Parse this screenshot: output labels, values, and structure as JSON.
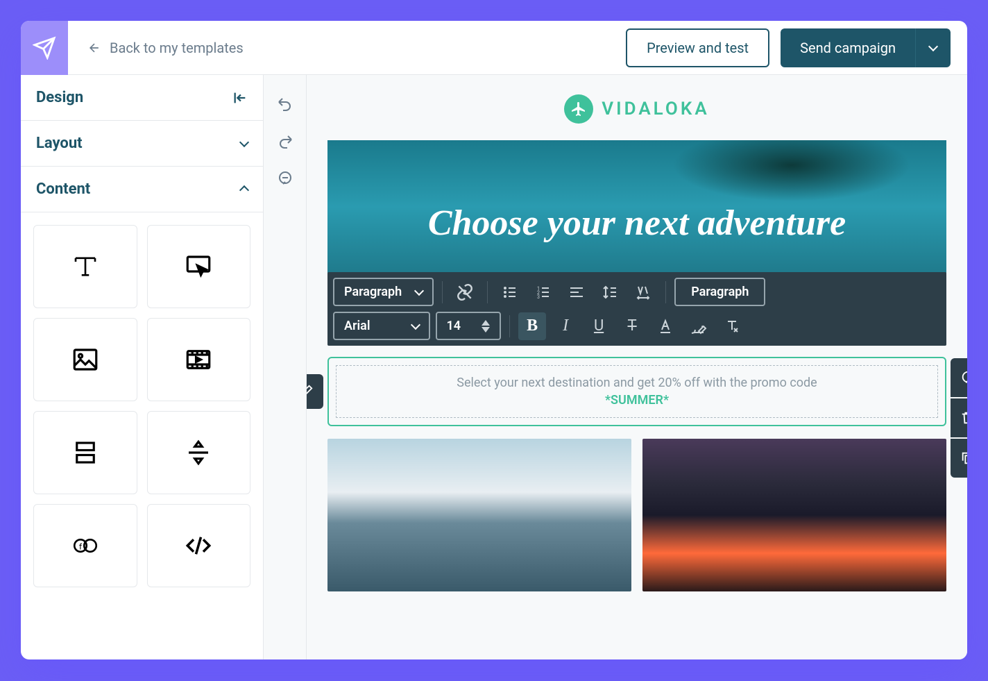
{
  "header": {
    "back_label": "Back to my templates",
    "preview_label": "Preview and test",
    "send_label": "Send campaign"
  },
  "sidebar": {
    "design_label": "Design",
    "layout_label": "Layout",
    "content_label": "Content"
  },
  "brand": {
    "name": "VIDALOKA"
  },
  "hero": {
    "title": "Choose your next adventure"
  },
  "rte": {
    "style_select": "Paragraph",
    "font_select": "Arial",
    "size_value": "14",
    "paragraph_btn": "Paragraph"
  },
  "edit_block": {
    "line1": "Select your next destination and get 20% off with the promo code",
    "line2": "*SUMMER*"
  },
  "colors": {
    "primary": "#1e5568",
    "accent": "#3fc19b",
    "toolbar": "#2d3e48"
  }
}
